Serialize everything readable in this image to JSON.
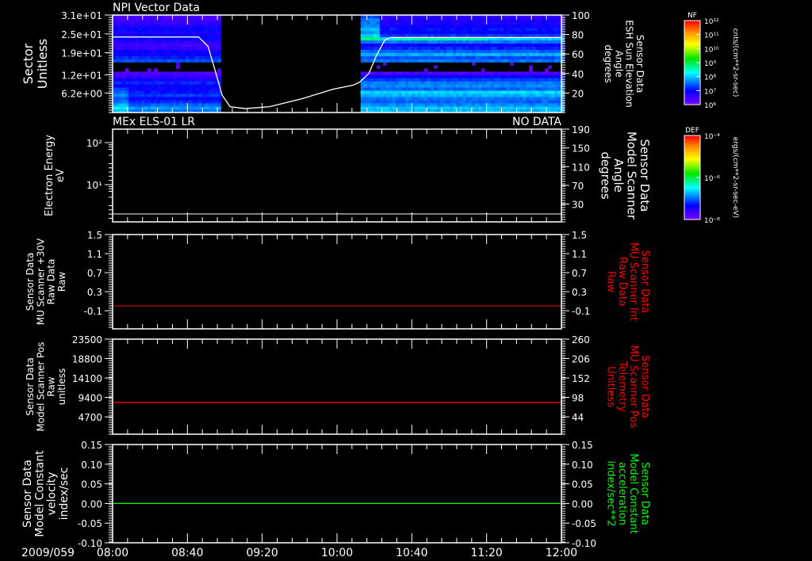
{
  "title": "NPI Vector Data",
  "time_axis": {
    "date_label": "2009/059",
    "start": "08:00",
    "end": "12:00",
    "tick_labels": [
      "08:00",
      "08:40",
      "09:20",
      "10:00",
      "10:40",
      "11:20",
      "12:00"
    ],
    "minor_tick_minutes": 8
  },
  "chart_data": [
    {
      "type": "heatmap",
      "panel_title": "NPI Vector Data",
      "ylabel": [
        "Sector",
        "Unitless"
      ],
      "ytick_labels": [
        "3.1e+01",
        "2.5e+01",
        "1.9e+01",
        "1.2e+01",
        "6.2e+00"
      ],
      "ytick_values": [
        31,
        25,
        19,
        12,
        6.2
      ],
      "ylim": [
        0,
        31
      ],
      "data_gap": [
        "08:58",
        "10:12"
      ],
      "sector_log_nf_before_gap": [
        7.6,
        7.8,
        7.5,
        7.2,
        7.0,
        7.3,
        7.1,
        6.9,
        7.0,
        7.2,
        6.8,
        6.6,
        6.4,
        null,
        null,
        null,
        7.4,
        7.2,
        7.0,
        6.9,
        6.6,
        6.5,
        6.7,
        7.0,
        6.9,
        6.8,
        7.0,
        6.8,
        6.6,
        6.5,
        6.4
      ],
      "sector_log_nf_after_gap": [
        7.9,
        8.0,
        7.7,
        7.5,
        7.6,
        7.9,
        8.1,
        7.5,
        7.7,
        7.6,
        7.3,
        7.0,
        6.4,
        null,
        null,
        null,
        7.6,
        7.4,
        7.9,
        7.5,
        7.2,
        6.9,
        7.6,
        8.0,
        7.3,
        7.0,
        7.1,
        6.9,
        6.8,
        6.8,
        6.6
      ],
      "colorbar": {
        "title": "NF",
        "log_range": [
          6,
          12
        ],
        "tick_labels": [
          "10¹²",
          "10¹¹",
          "10¹⁰",
          "10⁹",
          "10⁸",
          "10⁷",
          "10⁶"
        ],
        "units": "cnts/(cm**2-sr-sec)"
      },
      "overlay_series": {
        "name": "Sensor Data ESH Sun Elevation Angle",
        "right_label": [
          "Sensor Data",
          "ESH Sun Elevation",
          "Angle",
          "degrees"
        ],
        "right_ytick_labels": [
          "100",
          "80",
          "60",
          "40",
          "20"
        ],
        "right_ytick_values": [
          100,
          80,
          60,
          40,
          20
        ],
        "right_ylim": [
          0,
          100
        ],
        "color": "#ffffff",
        "minutes": [
          0,
          46,
          51,
          55,
          58.5,
          62.8,
          71,
          84,
          101,
          118,
          128.5,
          132,
          137,
          141,
          145.4,
          148.4,
          240
        ],
        "values": [
          77.5,
          77.5,
          68,
          42,
          18,
          6,
          4,
          6,
          14,
          24,
          28,
          31,
          40,
          58,
          74,
          77,
          77
        ]
      }
    },
    {
      "type": "line",
      "panel_title": "MEx ELS-01 LR",
      "status": "NO DATA",
      "ylabel": [
        "Electron Energy",
        "eV"
      ],
      "ytick_labels": [
        "10²",
        "10¹"
      ],
      "log_scale": true,
      "colorbar": {
        "title": "DEF",
        "tick_labels": [
          "10⁻⁴",
          "10⁻⁶",
          "10⁻⁸"
        ],
        "units": "ergs/(cm**2-sr-sec-eV)"
      },
      "overlay_series": {
        "right_label": [
          "Sensor Data",
          "Model Scanner",
          "Angle",
          "degrees"
        ],
        "right_ytick_labels": [
          "190",
          "150",
          "110",
          "70",
          "30"
        ],
        "right_ytick_values": [
          190,
          150,
          110,
          70,
          30
        ],
        "right_ylim": [
          -8,
          190
        ],
        "color": "#ffffff",
        "value": 9
      }
    },
    {
      "type": "line",
      "ylabel": [
        "Sensor Data",
        "MU Scanner +30V",
        "Raw Data",
        "Raw"
      ],
      "ytick_labels": [
        "1.5",
        "1.1",
        "0.7",
        "0.3",
        "-0.1"
      ],
      "ytick_values": [
        1.5,
        1.1,
        0.7,
        0.3,
        -0.1
      ],
      "ylim": [
        -0.48,
        1.5
      ],
      "right_label": [
        "Sensor Data",
        "MU Scanner Int",
        "Raw Data",
        "Raw"
      ],
      "right_label_color": "#ff0000",
      "series_color": "#c00000",
      "value": 0.0
    },
    {
      "type": "line",
      "ylabel": [
        "Sensor Data",
        "Model Scanner Pos",
        "Raw",
        "unitless"
      ],
      "ytick_labels": [
        "23500",
        "18800",
        "14100",
        "9400",
        "4700"
      ],
      "ytick_values": [
        23500,
        18800,
        14100,
        9400,
        4700
      ],
      "ylim": [
        500,
        23500
      ],
      "right_ytick_labels": [
        "260",
        "206",
        "152",
        "98",
        "44"
      ],
      "right_label": [
        "Sensor Data",
        "MU Scanner Pos",
        "Telemetry",
        "Unitless"
      ],
      "right_label_color": "#ff0000",
      "series_color": "#ff0000",
      "value": 8200
    },
    {
      "type": "line",
      "ylabel": [
        "Sensor Data",
        "Model Constant",
        "velocity",
        "index/sec"
      ],
      "ytick_labels": [
        "0.15",
        "0.10",
        "0.05",
        "0.00",
        "-0.05",
        "-0.10"
      ],
      "ytick_values": [
        0.15,
        0.1,
        0.05,
        0.0,
        -0.05,
        -0.1
      ],
      "ylim": [
        -0.1,
        0.15
      ],
      "right_label": [
        "Sensor Data",
        "Model Constant",
        "acceleration",
        "index/sec**2"
      ],
      "right_label_color": "#00ff00",
      "series_color": "#00ff00",
      "value": 0.0
    }
  ]
}
